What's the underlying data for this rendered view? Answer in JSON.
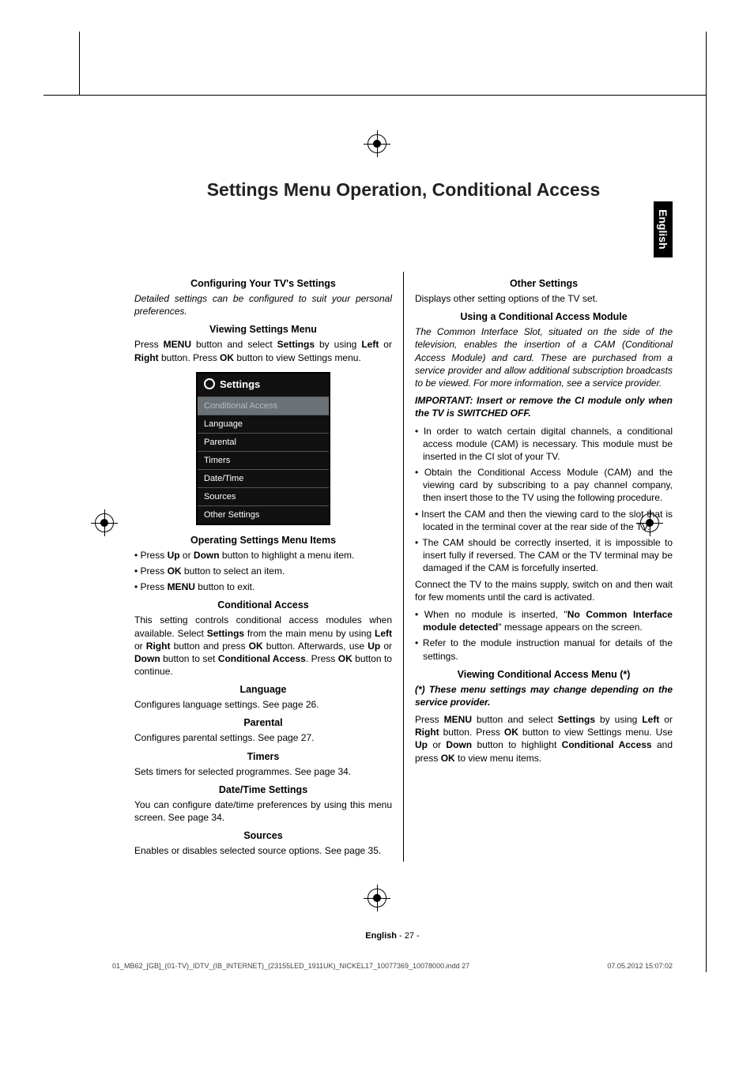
{
  "page": {
    "title": "Settings Menu Operation, Conditional Access",
    "language_tab": "English",
    "footer_lang_label": "English",
    "footer_page": "   - 27 -",
    "footer_file": "01_MB62_[GB]_(01-TV)_IDTV_(IB_INTERNET)_(23155LED_1911UK)_NICKEL17_10077369_10078000.indd   27",
    "footer_time": "07.05.2012   15:07:02"
  },
  "left": {
    "h1": "Configuring Your TV's Settings",
    "p1": "Detailed settings can be configured to suit your personal preferences.",
    "h2": "Viewing Settings Menu",
    "p2a": "Press ",
    "p2b": "MENU",
    "p2c": " button and select ",
    "p2d": "Settings",
    "p2e": " by using ",
    "p2f": "Left",
    "p2g": " or ",
    "p2h": "Right",
    "p2i": " button. Press ",
    "p2j": "OK",
    "p2k": " button to view Settings menu.",
    "settings_title": "Settings",
    "menu_items": {
      "i0": "Conditional Access",
      "i1": "Language",
      "i2": "Parental",
      "i3": "Timers",
      "i4": "Date/Time",
      "i5": "Sources",
      "i6": "Other Settings"
    },
    "h3": "Operating Settings Menu Items",
    "li1a": "Press ",
    "li1b": "Up",
    "li1c": " or ",
    "li1d": "Down",
    "li1e": " button to highlight a menu item.",
    "li2a": "Press ",
    "li2b": "OK",
    "li2c": " button to select an item.",
    "li3a": "Press ",
    "li3b": "MENU",
    "li3c": " button to exit.",
    "h4": "Conditional Access",
    "p4a": "This setting controls conditional access modules when available. Select ",
    "p4b": "Settings",
    "p4c": " from the main menu by using ",
    "p4d": "Left",
    "p4e": " or ",
    "p4f": "Right",
    "p4g": " button and press ",
    "p4h": "OK",
    "p4i": " button. Afterwards, use ",
    "p4j": "Up",
    "p4k": " or ",
    "p4l": "Down",
    "p4m": " button to set ",
    "p4n": "Conditional Access",
    "p4o": ". Press ",
    "p4p": "OK",
    "p4q": " button to continue.",
    "h5": "Language",
    "p5": "Configures language settings. See page 26.",
    "h6": "Parental",
    "p6": "Configures parental settings. See page 27.",
    "h7": "Timers",
    "p7": "Sets timers for selected programmes. See page 34.",
    "h8": "Date/Time Settings",
    "p8": "You can configure date/time preferences by using this menu screen. See page 34.",
    "h9": "Sources",
    "p9": "Enables or disables selected source options. See page 35."
  },
  "right": {
    "h1": "Other Settings",
    "p1": "Displays other setting options of the TV set.",
    "h2": "Using a Conditional Access Module",
    "p2": "The Common Interface Slot, situated on the side of the television, enables the insertion of a CAM (Conditional Access Module) and card. These are purchased from a service provider and allow additional subscription broadcasts to be viewed. For more information, see a service provider.",
    "p3": "IMPORTANT: Insert or remove the CI module only when the TV is SWITCHED OFF.",
    "li1": "In order to watch certain digital channels, a conditional access module (CAM) is necessary. This module must be inserted in the CI slot of your TV.",
    "li2": "Obtain the Conditional Access Module (CAM) and the viewing card by subscribing to a pay channel company, then insert those to the TV using the following procedure.",
    "li3": "Insert the CAM and then the viewing card to the slot that is located in the terminal cover at the rear side of the TV.",
    "li4": "The CAM should be correctly inserted, it is impossible to insert fully if reversed. The CAM or the TV terminal may be damaged if the CAM is forcefully inserted.",
    "p4": "Connect the TV to the mains supply, switch on and then wait for few moments until the card is activated.",
    "li5a": "When no module is inserted, \"",
    "li5b": "No Common Interface module detected",
    "li5c": "\" message appears on the screen.",
    "li6": "Refer to the module instruction manual for details of the settings.",
    "h3": "Viewing Conditional Access Menu (*)",
    "p5": "(*) These menu settings may change depending on the service provider.",
    "p6a": "Press ",
    "p6b": "MENU",
    "p6c": " button and select ",
    "p6d": "Settings",
    "p6e": " by using ",
    "p6f": "Left",
    "p6g": " or ",
    "p6h": "Right",
    "p6i": " button. Press ",
    "p6j": "OK",
    "p6k": " button to view Settings menu. Use ",
    "p6l": "Up",
    "p6m": " or ",
    "p6n": "Down",
    "p6o": " button to highlight ",
    "p6p": "Conditional Access",
    "p6q": " and press ",
    "p6r": "OK",
    "p6s": " to view menu items."
  }
}
